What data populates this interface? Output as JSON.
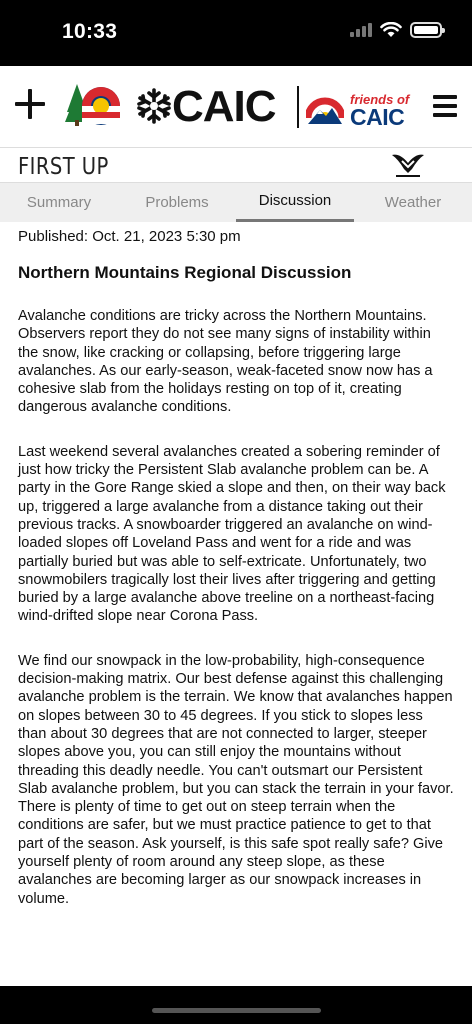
{
  "status": {
    "time": "10:33"
  },
  "header": {
    "logo_text": "CAIC",
    "friends_of": "friends of",
    "friends_caic": "CAIC",
    "sponsor": "FIRST UP"
  },
  "tabs": [
    {
      "label": "Summary",
      "active": false
    },
    {
      "label": "Problems",
      "active": false
    },
    {
      "label": "Discussion",
      "active": true
    },
    {
      "label": "Weather",
      "active": false
    }
  ],
  "article": {
    "published": "Published: Oct. 21, 2023 5:30 pm",
    "heading": "Northern Mountains Regional Discussion",
    "paragraphs": [
      "Avalanche conditions are tricky across the Northern Mountains. Observers report they do not see many signs of instability within the snow, like cracking or collapsing, before triggering large avalanches. As our early-season, weak-faceted snow now has a cohesive slab from the holidays resting on top of it, creating dangerous avalanche conditions.",
      "Last weekend several avalanches created a sobering reminder of just how tricky the Persistent Slab avalanche problem can be. A party in the Gore Range skied a slope and then, on their way back up, triggered a large avalanche from a distance taking out their previous tracks. A snowboarder triggered an avalanche on wind-loaded slopes off Loveland Pass and went for a ride and was partially buried but was able to self-extricate. Unfortunately, two snowmobilers tragically lost their lives after triggering and getting buried by a large avalanche above treeline on a northeast-facing wind-drifted slope near Corona Pass.",
      "We find our snowpack in the low-probability, high-consequence decision-making matrix. Our best defense against this challenging avalanche problem is the terrain. We know that avalanches happen on slopes between 30 to 45 degrees. If you stick to slopes less than about 30 degrees that are not connected to larger, steeper slopes above you, you can still enjoy the mountains without threading this deadly needle. You can't outsmart our Persistent Slab avalanche problem, but you can stack the terrain in your favor. There is plenty of time to get out on steep terrain when the conditions are safer, but we must practice patience to get to that part of the season. Ask yourself, is this safe spot really safe? Give yourself plenty of room around any steep slope, as these avalanches are becoming larger as our snowpack increases in volume."
    ]
  },
  "colors": {
    "co_red": "#d8292f",
    "co_blue": "#0b3a7a",
    "co_yellow": "#f5c400",
    "tree_green": "#1e7a34"
  }
}
